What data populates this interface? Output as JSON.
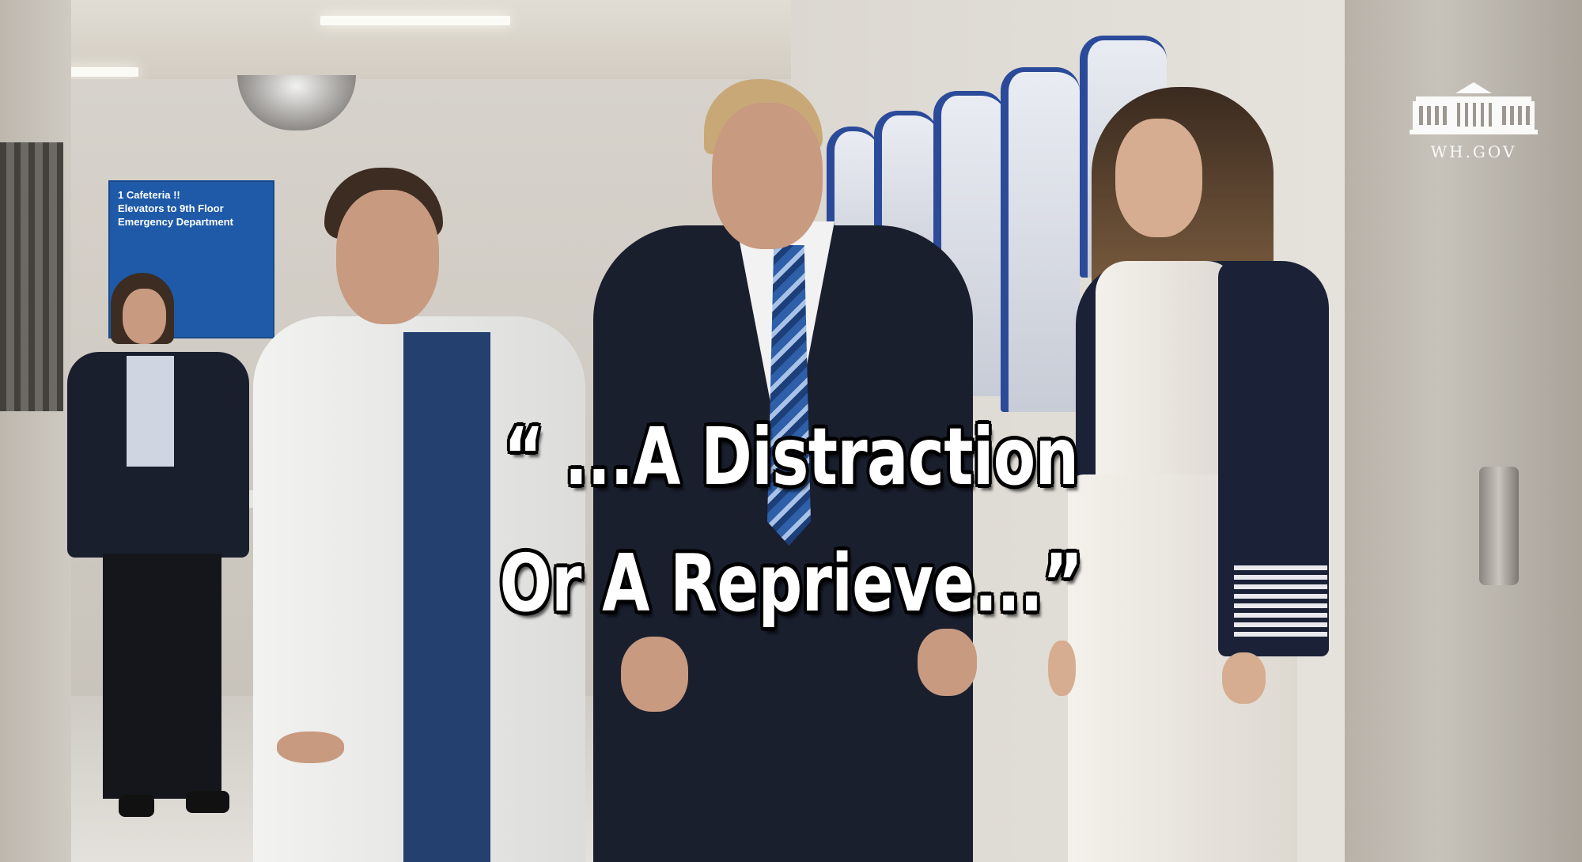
{
  "sign": {
    "lines": [
      "1 Cafeteria !!",
      "Elevators to 9th Floor",
      "Emergency Department"
    ]
  },
  "watermark": {
    "text": "WH.GOV",
    "icon": "white-house-icon"
  },
  "caption": {
    "line1": "“ ...A Distraction",
    "line2": "Or A Reprieve...”"
  },
  "colors": {
    "sign_blue": "#1e5aa8",
    "plaque_blue": "#2b4a9a",
    "caption_text": "#ffffff",
    "caption_outline": "#000000"
  }
}
